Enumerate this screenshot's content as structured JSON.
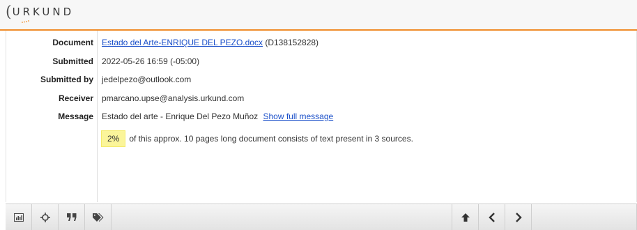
{
  "brand": {
    "logo_text": "URKUND"
  },
  "document": {
    "label": "Document",
    "link_text": "Estado del Arte-ENRIQUE DEL PEZO.docx",
    "id_text": "(D138152828)"
  },
  "submitted": {
    "label": "Submitted",
    "value": "2022-05-26 16:59 (-05:00)"
  },
  "submitted_by": {
    "label": "Submitted by",
    "value": "jedelpezo@outlook.com"
  },
  "receiver": {
    "label": "Receiver",
    "value": "pmarcano.upse@analysis.urkund.com"
  },
  "message": {
    "label": "Message",
    "value": "Estado del arte - Enrique Del Pezo Muñoz",
    "link_text": "Show full message"
  },
  "summary": {
    "percent": "2%",
    "text": "of this approx. 10 pages long document consists of text present in 3 sources."
  },
  "toolbar": {
    "icons": [
      "bar-chart-icon",
      "crosshair-icon",
      "quote-icon",
      "tags-icon",
      "arrow-up-icon",
      "chevron-left-icon",
      "chevron-right-icon"
    ]
  },
  "colors": {
    "accent": "#f08c2a",
    "link": "#1a4fc9",
    "highlight": "#fbf59a"
  }
}
